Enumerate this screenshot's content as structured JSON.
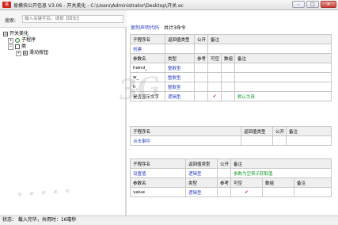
{
  "window": {
    "title": "易模块公开信息 V3.06 - 开关美化 - C:\\Users\\Administrator\\Desktop\\开关.ec",
    "app_icon_text": "易"
  },
  "search": {
    "label": "搜索:",
    "placeholder": "输入关键字后，请按【回车】"
  },
  "tree": {
    "root": "开关美化",
    "items": [
      "子程序",
      "类",
      "滑动按钮"
    ]
  },
  "toolbar": {
    "copy_link": "复制声明代码",
    "count_text": "共计3命令"
  },
  "table1": {
    "headers": [
      "子程序名",
      "返回值类型",
      "公开",
      "备注"
    ],
    "name": "创建",
    "param_headers": [
      "参数名",
      "类型",
      "参考",
      "可空",
      "数组",
      "备注"
    ],
    "params": [
      {
        "name": "hwnd_",
        "type": "整数型",
        "ref": "",
        "nullable": "",
        "array": "",
        "note": ""
      },
      {
        "name": "w_",
        "type": "整数型",
        "ref": "",
        "nullable": "",
        "array": "",
        "note": ""
      },
      {
        "name": "h_",
        "type": "整数型",
        "ref": "",
        "nullable": "",
        "array": "",
        "note": ""
      },
      {
        "name": "是否显示文字",
        "type": "逻辑型",
        "ref": "",
        "nullable": "✔",
        "array": "",
        "note": "默认为真"
      }
    ]
  },
  "table2": {
    "headers": [
      "子程序名",
      "返回值类型",
      "公开",
      "备注"
    ],
    "name": "点击事件"
  },
  "table3": {
    "headers": [
      "子程序名",
      "返回值类型",
      "公开",
      "备注"
    ],
    "name": "设置值",
    "return_type": "逻辑型",
    "note": "参数为空表示获取值",
    "param_headers": [
      "参数名",
      "类型",
      "参考",
      "可空",
      "数组",
      "备注"
    ],
    "params": [
      {
        "name": "value",
        "type": "逻辑型",
        "ref": "",
        "nullable": "✔",
        "array": "",
        "note": ""
      }
    ]
  },
  "status": {
    "text": "状态：  载入完毕，共用时：16毫秒"
  },
  "colors": {
    "link_blue": "#2a3fc1",
    "note_green": "#159a2b",
    "check_red": "#c11010"
  }
}
